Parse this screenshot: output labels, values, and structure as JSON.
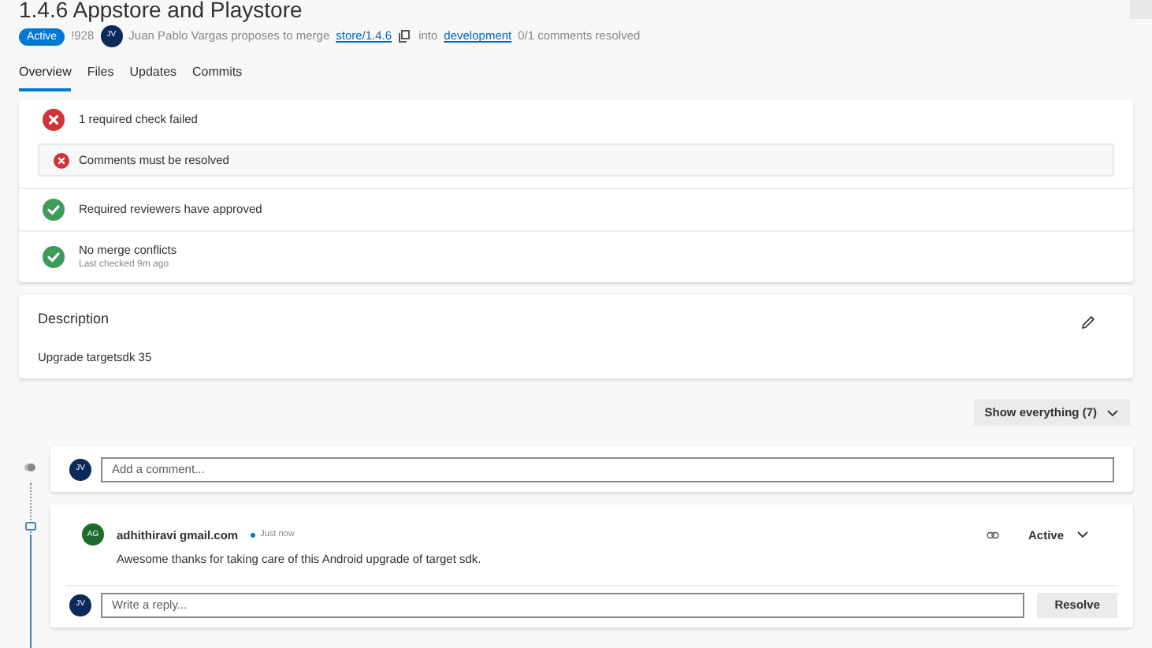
{
  "title": "1.4.6 Appstore and Playstore",
  "meta": {
    "status": "Active",
    "id": "!928",
    "author_initials": "JV",
    "text": "Juan Pablo Vargas proposes to merge",
    "source_branch": "store/1.4.6",
    "into": "into",
    "target_branch": "development",
    "comments_resolved": "0/1 comments resolved"
  },
  "tabs": [
    {
      "label": "Overview",
      "selected": true
    },
    {
      "label": "Files",
      "selected": false
    },
    {
      "label": "Updates",
      "selected": false
    },
    {
      "label": "Commits",
      "selected": false
    }
  ],
  "checks": [
    {
      "kind": "failed",
      "title": "1 required check failed",
      "children": [
        {
          "kind": "failed",
          "title": "Comments must be resolved"
        }
      ]
    },
    {
      "kind": "passed",
      "title": "Required reviewers have approved"
    },
    {
      "kind": "passed",
      "title": "No merge conflicts",
      "subtitle": "Last checked 9m ago"
    }
  ],
  "description": {
    "heading": "Description",
    "body": "Upgrade targetsdk 35"
  },
  "filter_button": "Show everything (7)",
  "new_comment": {
    "avatar_initials": "JV",
    "placeholder": "Add a comment..."
  },
  "thread": {
    "author_initials": "AG",
    "author": "adhithiravi gmail.com",
    "time": "Just now",
    "status": "Active",
    "text": "Awesome thanks for taking care of this Android upgrade of target sdk.",
    "reply_initials": "JV",
    "reply_placeholder": "Write a reply...",
    "resolve_button": "Resolve"
  }
}
